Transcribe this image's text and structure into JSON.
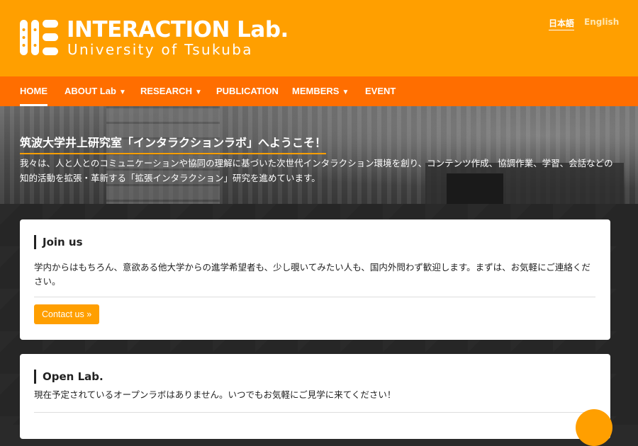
{
  "header": {
    "logo_title": "INTERACTION Lab.",
    "logo_subtitle": "University of Tsukuba",
    "lang": {
      "ja": "日本語",
      "en": "English"
    },
    "brand_color": "#ff9f00"
  },
  "nav": {
    "bg_color": "#ff6e00",
    "items": [
      {
        "label": "HOME",
        "active": true
      },
      {
        "label": "ABOUT Lab",
        "dropdown": true,
        "caret": "▼"
      },
      {
        "label": "RESEARCH",
        "dropdown": true,
        "caret": "▼"
      },
      {
        "label": "PUBLICATION"
      },
      {
        "label": "MEMBERS",
        "dropdown": true,
        "caret": "▼"
      },
      {
        "label": "EVENT"
      }
    ]
  },
  "hero": {
    "title": "筑波大学井上研究室「インタラクションラボ」へようこそ！",
    "description": "我々は、人と人とのコミュニケーションや協同の理解に基づいた次世代インタラクション環境を創り、コンテンツ作成、協調作業、学習、会話などの知的活動を拡張・革新する「拡張インタラクション」研究を進めています。"
  },
  "panels": {
    "join": {
      "heading": "Join us",
      "text": "学内からはもちろん、意欲ある他大学からの進学希望者も、少し覗いてみたい人も、国内外問わず歓迎します。まずは、お気軽にご連絡ください。",
      "button": "Contact us »"
    },
    "open_lab": {
      "heading": "Open Lab.",
      "text": "現在予定されているオープンラボはありません。いつでもお気軽にご見学に来てください！"
    }
  },
  "icons": {
    "logo": "interaction-lab-logo-icon",
    "fab": "scroll-top-icon"
  }
}
